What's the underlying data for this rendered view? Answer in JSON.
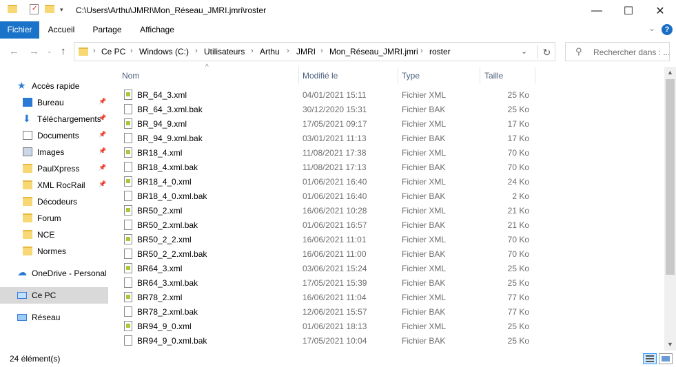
{
  "titlebar": {
    "path": "C:\\Users\\Arthu\\JMRI\\Mon_Réseau_JMRI.jmri\\roster",
    "minimize": "—",
    "maximize": "☐",
    "close": "✕"
  },
  "ribbon": {
    "tabs": [
      "Fichier",
      "Accueil",
      "Partage",
      "Affichage"
    ],
    "help": "?",
    "collapse": "⌄"
  },
  "address": {
    "crumbs": [
      "Ce PC",
      "Windows (C:)",
      "Utilisateurs",
      "Arthu",
      "JMRI",
      "Mon_Réseau_JMRI.jmri",
      "roster"
    ],
    "search_placeholder": "Rechercher dans : ..."
  },
  "sidebar": {
    "quick_access": "Accès rapide",
    "items": [
      {
        "label": "Bureau",
        "icon": "desktop-icon",
        "pinned": true
      },
      {
        "label": "Téléchargements",
        "icon": "download-icon",
        "pinned": true
      },
      {
        "label": "Documents",
        "icon": "documents-icon",
        "pinned": true
      },
      {
        "label": "Images",
        "icon": "images-icon",
        "pinned": true
      },
      {
        "label": "PaulXpress",
        "icon": "folder-icon",
        "pinned": true
      },
      {
        "label": "XML RocRail",
        "icon": "folder-icon",
        "pinned": true
      },
      {
        "label": "Décodeurs",
        "icon": "folder-icon",
        "pinned": false
      },
      {
        "label": "Forum",
        "icon": "folder-icon",
        "pinned": false
      },
      {
        "label": "NCE",
        "icon": "folder-icon",
        "pinned": false
      },
      {
        "label": "Normes",
        "icon": "folder-icon",
        "pinned": false
      }
    ],
    "onedrive": "OneDrive - Personal",
    "this_pc": "Ce PC",
    "network": "Réseau"
  },
  "columns": {
    "name": "Nom",
    "modified": "Modifié le",
    "type": "Type",
    "size": "Taille"
  },
  "files": [
    {
      "name": "BR_64_3.xml",
      "date": "04/01/2021 15:11",
      "type": "Fichier XML",
      "size": "25 Ko",
      "kind": "xml"
    },
    {
      "name": "BR_64_3.xml.bak",
      "date": "30/12/2020 15:31",
      "type": "Fichier BAK",
      "size": "25 Ko",
      "kind": "bak"
    },
    {
      "name": "BR_94_9.xml",
      "date": "17/05/2021 09:17",
      "type": "Fichier XML",
      "size": "17 Ko",
      "kind": "xml"
    },
    {
      "name": "BR_94_9.xml.bak",
      "date": "03/01/2021 11:13",
      "type": "Fichier BAK",
      "size": "17 Ko",
      "kind": "bak"
    },
    {
      "name": "BR18_4.xml",
      "date": "11/08/2021 17:38",
      "type": "Fichier XML",
      "size": "70 Ko",
      "kind": "xml"
    },
    {
      "name": "BR18_4.xml.bak",
      "date": "11/08/2021 17:13",
      "type": "Fichier BAK",
      "size": "70 Ko",
      "kind": "bak"
    },
    {
      "name": "BR18_4_0.xml",
      "date": "01/06/2021 16:40",
      "type": "Fichier XML",
      "size": "24 Ko",
      "kind": "xml"
    },
    {
      "name": "BR18_4_0.xml.bak",
      "date": "01/06/2021 16:40",
      "type": "Fichier BAK",
      "size": "2 Ko",
      "kind": "bak"
    },
    {
      "name": "BR50_2.xml",
      "date": "16/06/2021 10:28",
      "type": "Fichier XML",
      "size": "21 Ko",
      "kind": "xml"
    },
    {
      "name": "BR50_2.xml.bak",
      "date": "01/06/2021 16:57",
      "type": "Fichier BAK",
      "size": "21 Ko",
      "kind": "bak"
    },
    {
      "name": "BR50_2_2.xml",
      "date": "16/06/2021 11:01",
      "type": "Fichier XML",
      "size": "70 Ko",
      "kind": "xml"
    },
    {
      "name": "BR50_2_2.xml.bak",
      "date": "16/06/2021 11:00",
      "type": "Fichier BAK",
      "size": "70 Ko",
      "kind": "bak"
    },
    {
      "name": "BR64_3.xml",
      "date": "03/06/2021 15:24",
      "type": "Fichier XML",
      "size": "25 Ko",
      "kind": "xml"
    },
    {
      "name": "BR64_3.xml.bak",
      "date": "17/05/2021 15:39",
      "type": "Fichier BAK",
      "size": "25 Ko",
      "kind": "bak"
    },
    {
      "name": "BR78_2.xml",
      "date": "16/06/2021 11:04",
      "type": "Fichier XML",
      "size": "77 Ko",
      "kind": "xml"
    },
    {
      "name": "BR78_2.xml.bak",
      "date": "12/06/2021 15:57",
      "type": "Fichier BAK",
      "size": "77 Ko",
      "kind": "bak"
    },
    {
      "name": "BR94_9_0.xml",
      "date": "01/06/2021 18:13",
      "type": "Fichier XML",
      "size": "25 Ko",
      "kind": "xml"
    },
    {
      "name": "BR94_9_0.xml.bak",
      "date": "17/05/2021 10:04",
      "type": "Fichier BAK",
      "size": "25 Ko",
      "kind": "bak"
    }
  ],
  "status": {
    "count": "24 élément(s)"
  }
}
